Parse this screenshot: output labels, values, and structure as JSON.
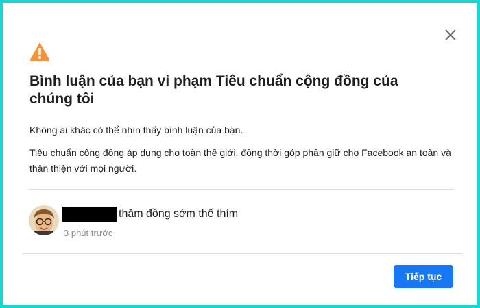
{
  "dialog": {
    "icons": {
      "close": "close-icon",
      "warning": "warning-icon"
    },
    "colors": {
      "warning": "#f5933c",
      "primary": "#1877f2",
      "frame": "#17d6d6"
    },
    "title": "Bình luận của bạn vi phạm Tiêu chuẩn cộng đồng của chúng tôi",
    "paragraph_1": "Không ai khác có thể nhìn thấy bình luận của bạn.",
    "paragraph_2": "Tiêu chuẩn cộng đồng áp dụng cho toàn thế giới, đồng thời góp phần giữ cho Facebook an toàn và thân thiện với mọi người.",
    "comment": {
      "text": "thăm đồng sớm thế thím",
      "timestamp": "3 phút trước"
    },
    "continue_label": "Tiếp tục"
  }
}
